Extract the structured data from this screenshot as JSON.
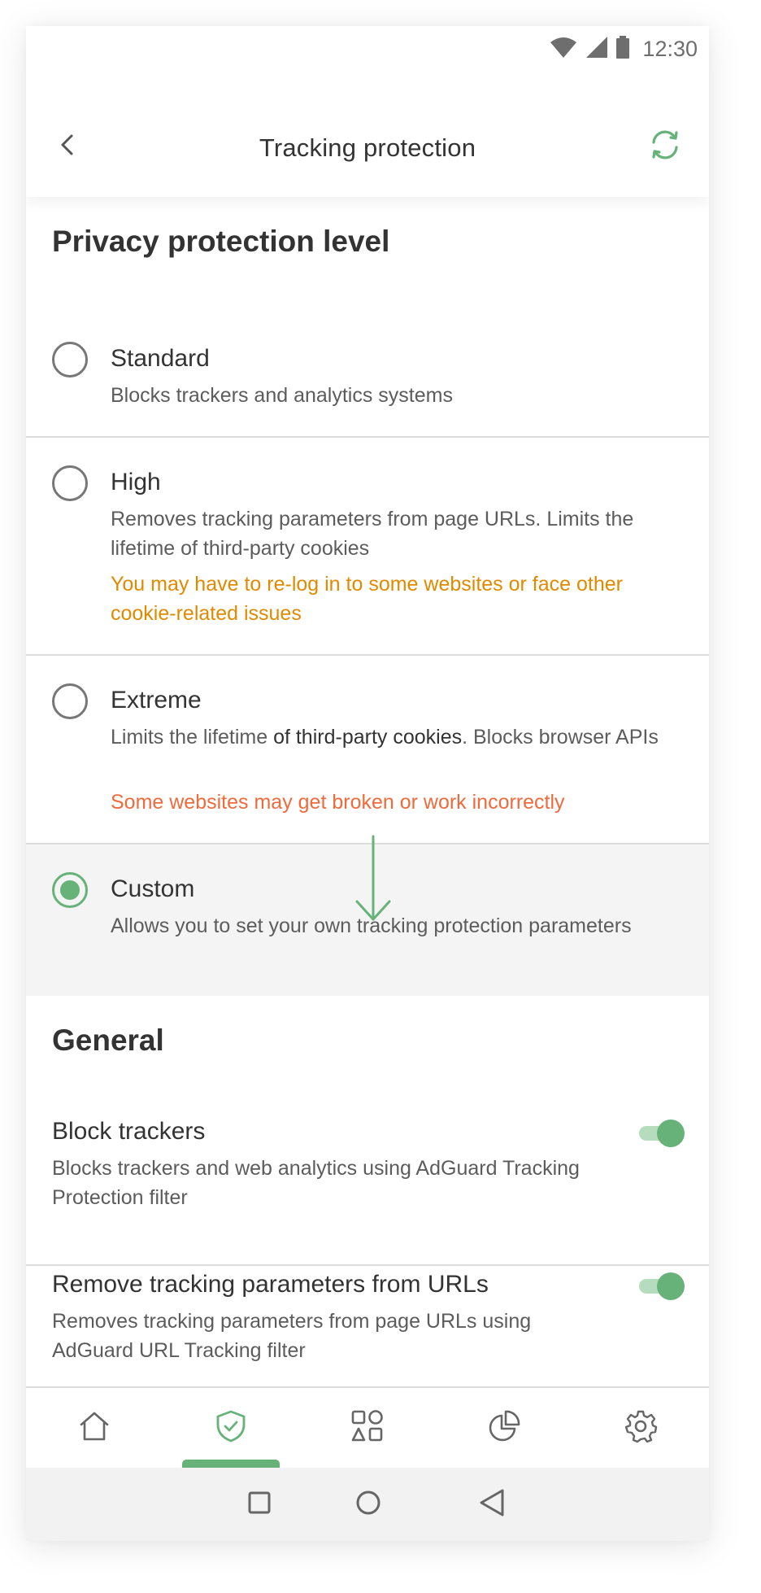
{
  "status_bar": {
    "time": "12:30",
    "icons": [
      "wifi-icon",
      "cellular-signal-icon",
      "battery-icon"
    ]
  },
  "app_bar": {
    "title": "Tracking protection",
    "back_icon": "chevron-left-icon",
    "refresh_icon": "sync-icon"
  },
  "privacy_level": {
    "title": "Privacy protection level",
    "options": [
      {
        "label": "Standard",
        "description": "Blocks trackers and analytics systems",
        "selected": false
      },
      {
        "label": "High",
        "description": "Removes tracking parameters from page URLs. Limits the lifetime of third-party cookies",
        "warning": "You may have to re-log in to some websites or face other cookie-related issues",
        "warning_color": "#e08a00",
        "selected": false
      },
      {
        "label": "Extreme",
        "description_parts": [
          "Limits the lifetime ",
          "of third-party cookies",
          ". Blocks browser APIs"
        ],
        "warning": "Some websites may get broken or work incorrectly",
        "warning_color": "#f06a3c",
        "selected": false
      },
      {
        "label": "Custom",
        "description": "Allows you to set your own tracking protection parameters",
        "selected": true
      }
    ]
  },
  "general": {
    "title": "General",
    "settings": [
      {
        "label": "Block trackers",
        "description": "Blocks trackers and web analytics using AdGuard Tracking Protection filter",
        "enabled": true
      },
      {
        "label": "Remove tracking parameters from URLs",
        "description": "Removes tracking parameters from page URLs using AdGuard URL Tracking filter",
        "enabled": true
      }
    ]
  },
  "bottom_nav": {
    "items": [
      "home-icon",
      "shield-check-icon",
      "apps-grid-icon",
      "statistics-pie-icon",
      "settings-gear-icon"
    ],
    "active": "shield-check-icon"
  },
  "colors": {
    "accent": "#67b279",
    "accent_light": "#b5dcbd",
    "text": "#333333",
    "secondary_text": "#5c5c5c"
  }
}
